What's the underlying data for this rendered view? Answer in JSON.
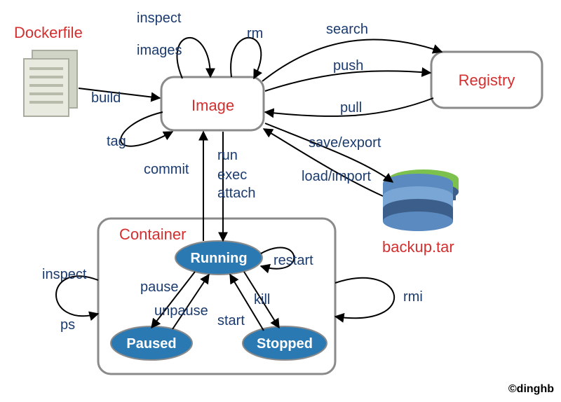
{
  "nodes": {
    "dockerfile": "Dockerfile",
    "image": "Image",
    "registry": "Registry",
    "container": "Container",
    "backup": "backup.tar"
  },
  "states": {
    "running": "Running",
    "paused": "Paused",
    "stopped": "Stopped"
  },
  "edges": {
    "build": "build",
    "inspect_img": "inspect",
    "images": "images",
    "rm": "rm",
    "tag": "tag",
    "search": "search",
    "push": "push",
    "pull": "pull",
    "save_export": "save/export",
    "load_import": "load/import",
    "commit": "commit",
    "run": "run",
    "exec": "exec",
    "attach": "attach",
    "restart": "restart",
    "pause": "pause",
    "unpause": "unpause",
    "start": "start",
    "kill": "kill",
    "inspect_ctr": "inspect",
    "ps": "ps",
    "rmi": "rmi"
  },
  "credit": "©dinghb"
}
